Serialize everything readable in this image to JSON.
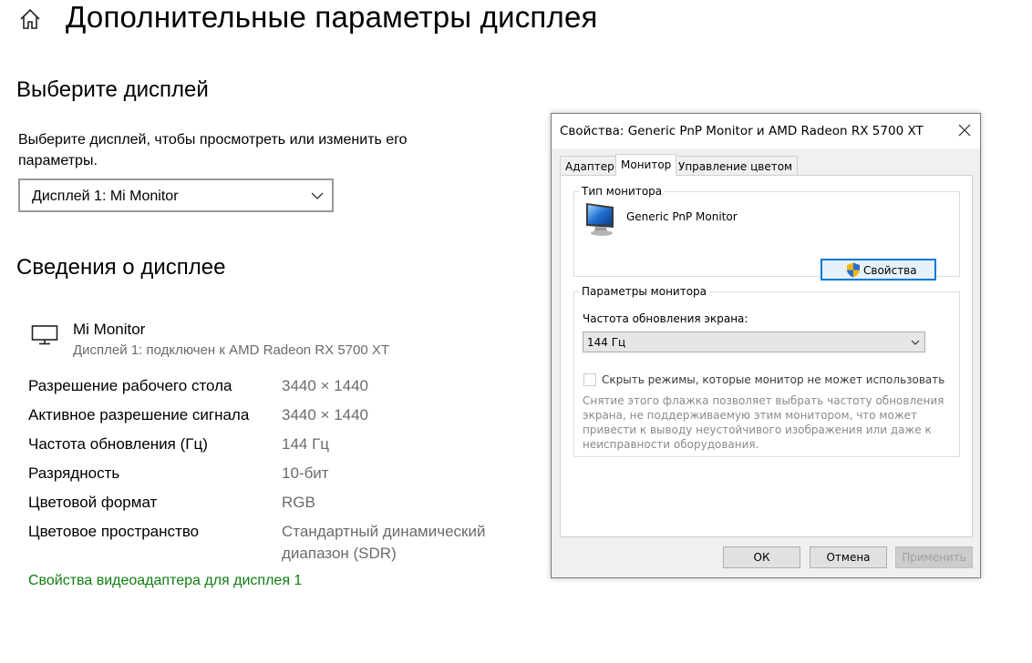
{
  "page": {
    "title": "Дополнительные параметры дисплея",
    "home_icon": "home-icon"
  },
  "select_display": {
    "heading": "Выберите дисплей",
    "description": "Выберите дисплей, чтобы просмотреть или изменить его параметры.",
    "dropdown_value": "Дисплей 1: Mi Monitor"
  },
  "display_info": {
    "heading": "Сведения о дисплее",
    "monitor_icon": "monitor-icon",
    "monitor_name": "Mi Monitor",
    "monitor_subtitle": "Дисплей 1: подключен к AMD Radeon RX 5700 XT",
    "specs": [
      {
        "label": "Разрешение рабочего стола",
        "value": "3440 × 1440"
      },
      {
        "label": "Активное разрешение сигнала",
        "value": "3440 × 1440"
      },
      {
        "label": "Частота обновления (Гц)",
        "value": "144 Гц"
      },
      {
        "label": "Разрядность",
        "value": "10-бит"
      },
      {
        "label": "Цветовой формат",
        "value": "RGB"
      },
      {
        "label": "Цветовое пространство",
        "value": "Стандартный динамический диапазон (SDR)"
      }
    ],
    "adapter_link": "Свойства видеоадаптера для дисплея 1",
    "link_color": "#107c10"
  },
  "dialog": {
    "title": "Свойства: Generic PnP Monitor и AMD Radeon RX 5700 XT",
    "tabs": [
      {
        "label": "Адаптер",
        "active": false
      },
      {
        "label": "Монитор",
        "active": true
      },
      {
        "label": "Управление цветом",
        "active": false
      }
    ],
    "monitor_type": {
      "group_label": "Тип монитора",
      "monitor_name": "Generic PnP Monitor",
      "properties_button": "Свойства"
    },
    "monitor_settings": {
      "group_label": "Параметры монитора",
      "refresh_label": "Частота обновления экрана:",
      "refresh_value": "144 Гц",
      "hide_modes_label": "Скрыть режимы, которые монитор не может использовать",
      "hide_modes_checked": false,
      "hide_modes_description": "Снятие этого флажка позволяет выбрать частоту обновления экрана, не поддерживаемую этим монитором, что может привести к выводу неустойчивого изображения или даже к неисправности оборудования."
    },
    "buttons": {
      "ok": "ОК",
      "cancel": "Отмена",
      "apply": "Применить"
    }
  }
}
